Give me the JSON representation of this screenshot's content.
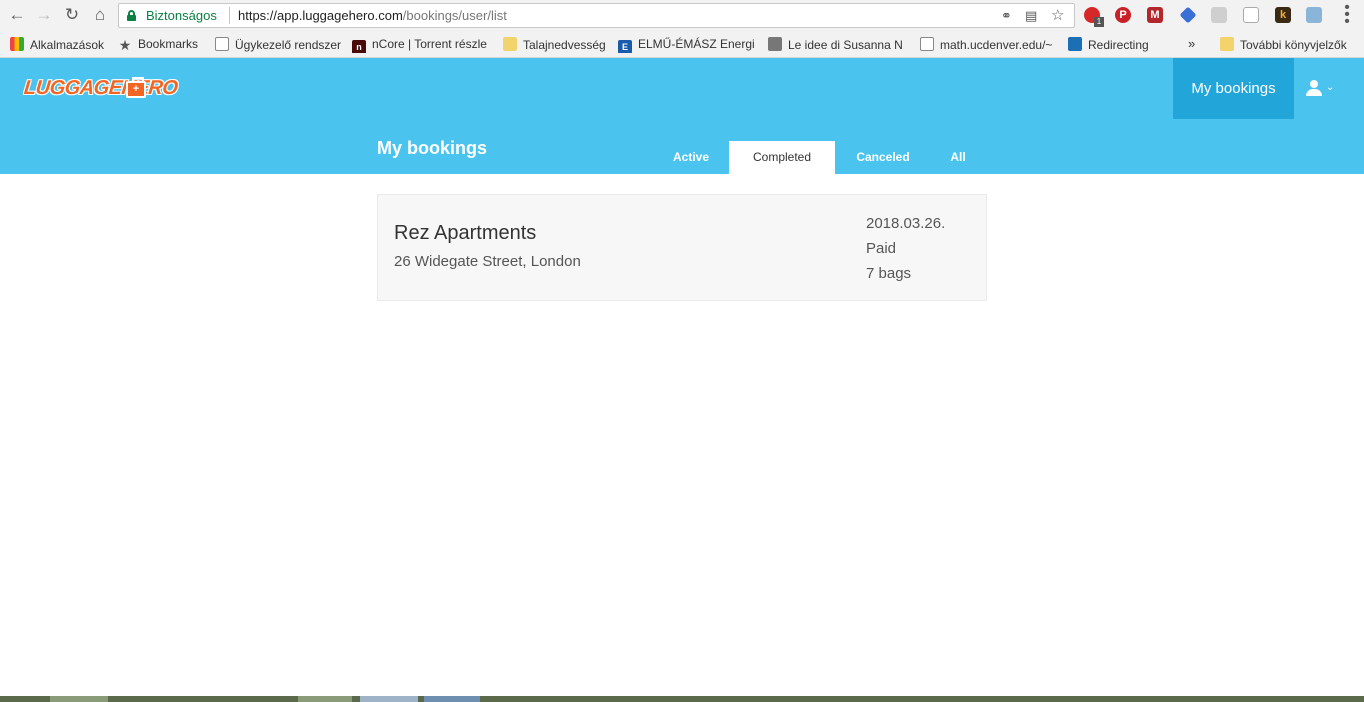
{
  "browser": {
    "secure_label": "Biztonságos",
    "url_host": "https://app.luggagehero.com",
    "url_path": "/bookings/user/list",
    "extension_badge": "1"
  },
  "bookmarks": [
    {
      "label": "Alkalmazások",
      "icon": "apps-grid-icon"
    },
    {
      "label": "Bookmarks",
      "icon": "star-icon"
    },
    {
      "label": "Ügykezelő rendszer",
      "icon": "page-icon"
    },
    {
      "label": "nCore | Torrent részle",
      "icon": "ncore-icon"
    },
    {
      "label": "Talajnedvesség",
      "icon": "folder-icon"
    },
    {
      "label": "ELMŰ-ÉMÁSZ Energi",
      "icon": "elmu-icon"
    },
    {
      "label": "Le idee di Susanna N",
      "icon": "image-icon"
    },
    {
      "label": "math.ucdenver.edu/~",
      "icon": "page-icon"
    },
    {
      "label": "Redirecting",
      "icon": "tab-icon"
    },
    {
      "label": "»",
      "icon": "chevron-icon"
    },
    {
      "label": "További könyvjelzők",
      "icon": "folder-icon"
    }
  ],
  "header": {
    "logo_text": "LUGGAGEHERO",
    "nav_active": "My bookings"
  },
  "subheader": {
    "title": "My bookings",
    "tabs": [
      "Active",
      "Completed",
      "Canceled",
      "All"
    ],
    "selected_tab": "Completed"
  },
  "bookings": [
    {
      "name": "Rez Apartments",
      "address": "26 Widegate Street, London",
      "date": "2018.03.26.",
      "status": "Paid",
      "bags": "7 bags"
    }
  ],
  "colors": {
    "header_blue": "#4ac4ee",
    "active_blue": "#22a6d9",
    "brand_orange": "#f26522"
  }
}
